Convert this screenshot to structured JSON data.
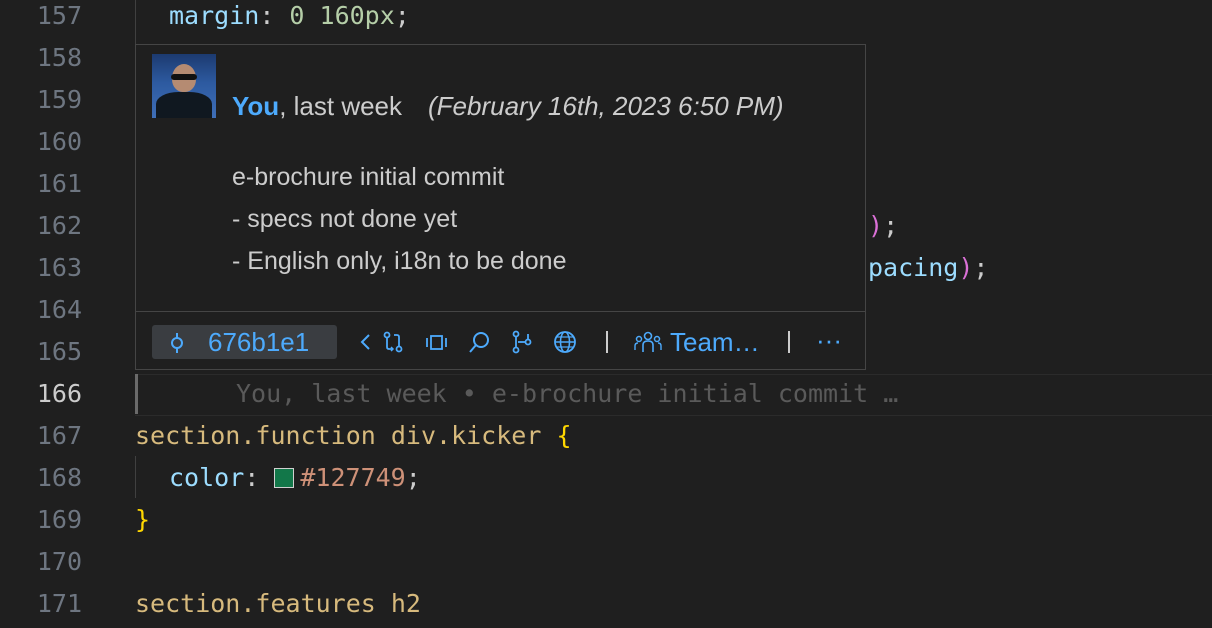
{
  "editor": {
    "lines": [
      {
        "num": "157"
      },
      {
        "num": "158"
      },
      {
        "num": "159"
      },
      {
        "num": "160"
      },
      {
        "num": "161"
      },
      {
        "num": "162"
      },
      {
        "num": "163"
      },
      {
        "num": "164"
      },
      {
        "num": "165"
      },
      {
        "num": "166"
      },
      {
        "num": "167"
      },
      {
        "num": "168"
      },
      {
        "num": "169"
      },
      {
        "num": "170"
      },
      {
        "num": "171"
      }
    ],
    "code": {
      "l157_prop": "margin",
      "l157_colon": ": ",
      "l157_value": "0 160px",
      "l157_semi": ";",
      "l162_paren": ")",
      "l162_semi": ";",
      "l163_tail": "pacing",
      "l163_paren": ")",
      "l163_semi": ";",
      "l167_selector": "section.function div.kicker ",
      "l167_brace": "{",
      "l168_prop": "color",
      "l168_colon": ": ",
      "l168_value": "#127749",
      "l168_semi": ";",
      "l169_brace": "}",
      "l171_text": "section.features h2"
    },
    "swatch_color": "#127749",
    "inline_blame": "You, last week • e-brochure initial commit …"
  },
  "hover": {
    "author": "You",
    "relative_time": ", last week",
    "date": "(February 16th, 2023 6:50 PM)",
    "message": [
      "e-brochure initial commit",
      "- specs not done yet",
      "- English only, i18n to be done"
    ],
    "sha": "676b1e1",
    "teams_label": "Team…",
    "separator": "|",
    "more": "···"
  }
}
